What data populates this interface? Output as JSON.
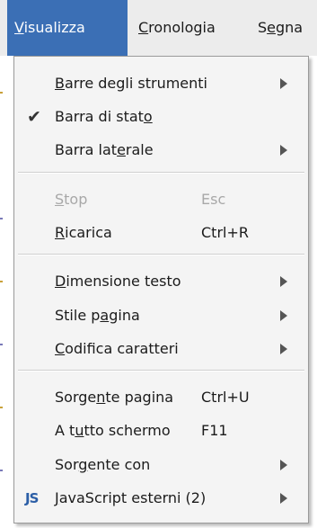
{
  "menubar": [
    {
      "pre": "",
      "mnemonic": "V",
      "post": "isualizza"
    },
    {
      "pre": "",
      "mnemonic": "C",
      "post": "ronologia"
    },
    {
      "pre": "S",
      "mnemonic": "e",
      "post": "gna"
    }
  ],
  "menu": {
    "items": [
      {
        "id": "barre-strumenti",
        "pre": "",
        "mn": "B",
        "post": "arre degli strumenti",
        "shortcut": "",
        "submenu": true,
        "checked": false,
        "disabled": false
      },
      {
        "id": "barra-stato",
        "pre": "Barra di stat",
        "mn": "o",
        "post": "",
        "shortcut": "",
        "submenu": false,
        "checked": true,
        "disabled": false
      },
      {
        "id": "barra-laterale",
        "pre": "Barra lat",
        "mn": "e",
        "post": "rale",
        "shortcut": "",
        "submenu": true,
        "checked": false,
        "disabled": false
      },
      {
        "id": "stop",
        "pre": "",
        "mn": "S",
        "post": "top",
        "shortcut": "Esc",
        "submenu": false,
        "checked": false,
        "disabled": true
      },
      {
        "id": "ricarica",
        "pre": "",
        "mn": "R",
        "post": "icarica",
        "shortcut": "Ctrl+R",
        "submenu": false,
        "checked": false,
        "disabled": false
      },
      {
        "id": "dimensione-testo",
        "pre": "",
        "mn": "D",
        "post": "imensione testo",
        "shortcut": "",
        "submenu": true,
        "checked": false,
        "disabled": false
      },
      {
        "id": "stile-pagina",
        "pre": "Stile p",
        "mn": "a",
        "post": "gina",
        "shortcut": "",
        "submenu": true,
        "checked": false,
        "disabled": false
      },
      {
        "id": "codifica-caratteri",
        "pre": "",
        "mn": "C",
        "post": "odifica caratteri",
        "shortcut": "",
        "submenu": true,
        "checked": false,
        "disabled": false
      },
      {
        "id": "sorgente-pagina",
        "pre": "Sorge",
        "mn": "n",
        "post": "te pagina",
        "shortcut": "Ctrl+U",
        "submenu": false,
        "checked": false,
        "disabled": false
      },
      {
        "id": "a-tutto-schermo",
        "pre": "A t",
        "mn": "u",
        "post": "tto schermo",
        "shortcut": "F11",
        "submenu": false,
        "checked": false,
        "disabled": false
      },
      {
        "id": "sorgente-con",
        "pre": "Sor",
        "mn": "g",
        "post": "ente con",
        "shortcut": "",
        "submenu": true,
        "checked": false,
        "disabled": false
      },
      {
        "id": "javascript-esterni",
        "pre": "",
        "mn": "J",
        "post": "avaScript esterni (2)",
        "shortcut": "",
        "submenu": true,
        "checked": false,
        "disabled": false,
        "icon": "JS"
      }
    ]
  },
  "icons": {
    "check": "check-icon",
    "submenu": "submenu-arrow-icon",
    "javascript": "javascript-icon"
  }
}
